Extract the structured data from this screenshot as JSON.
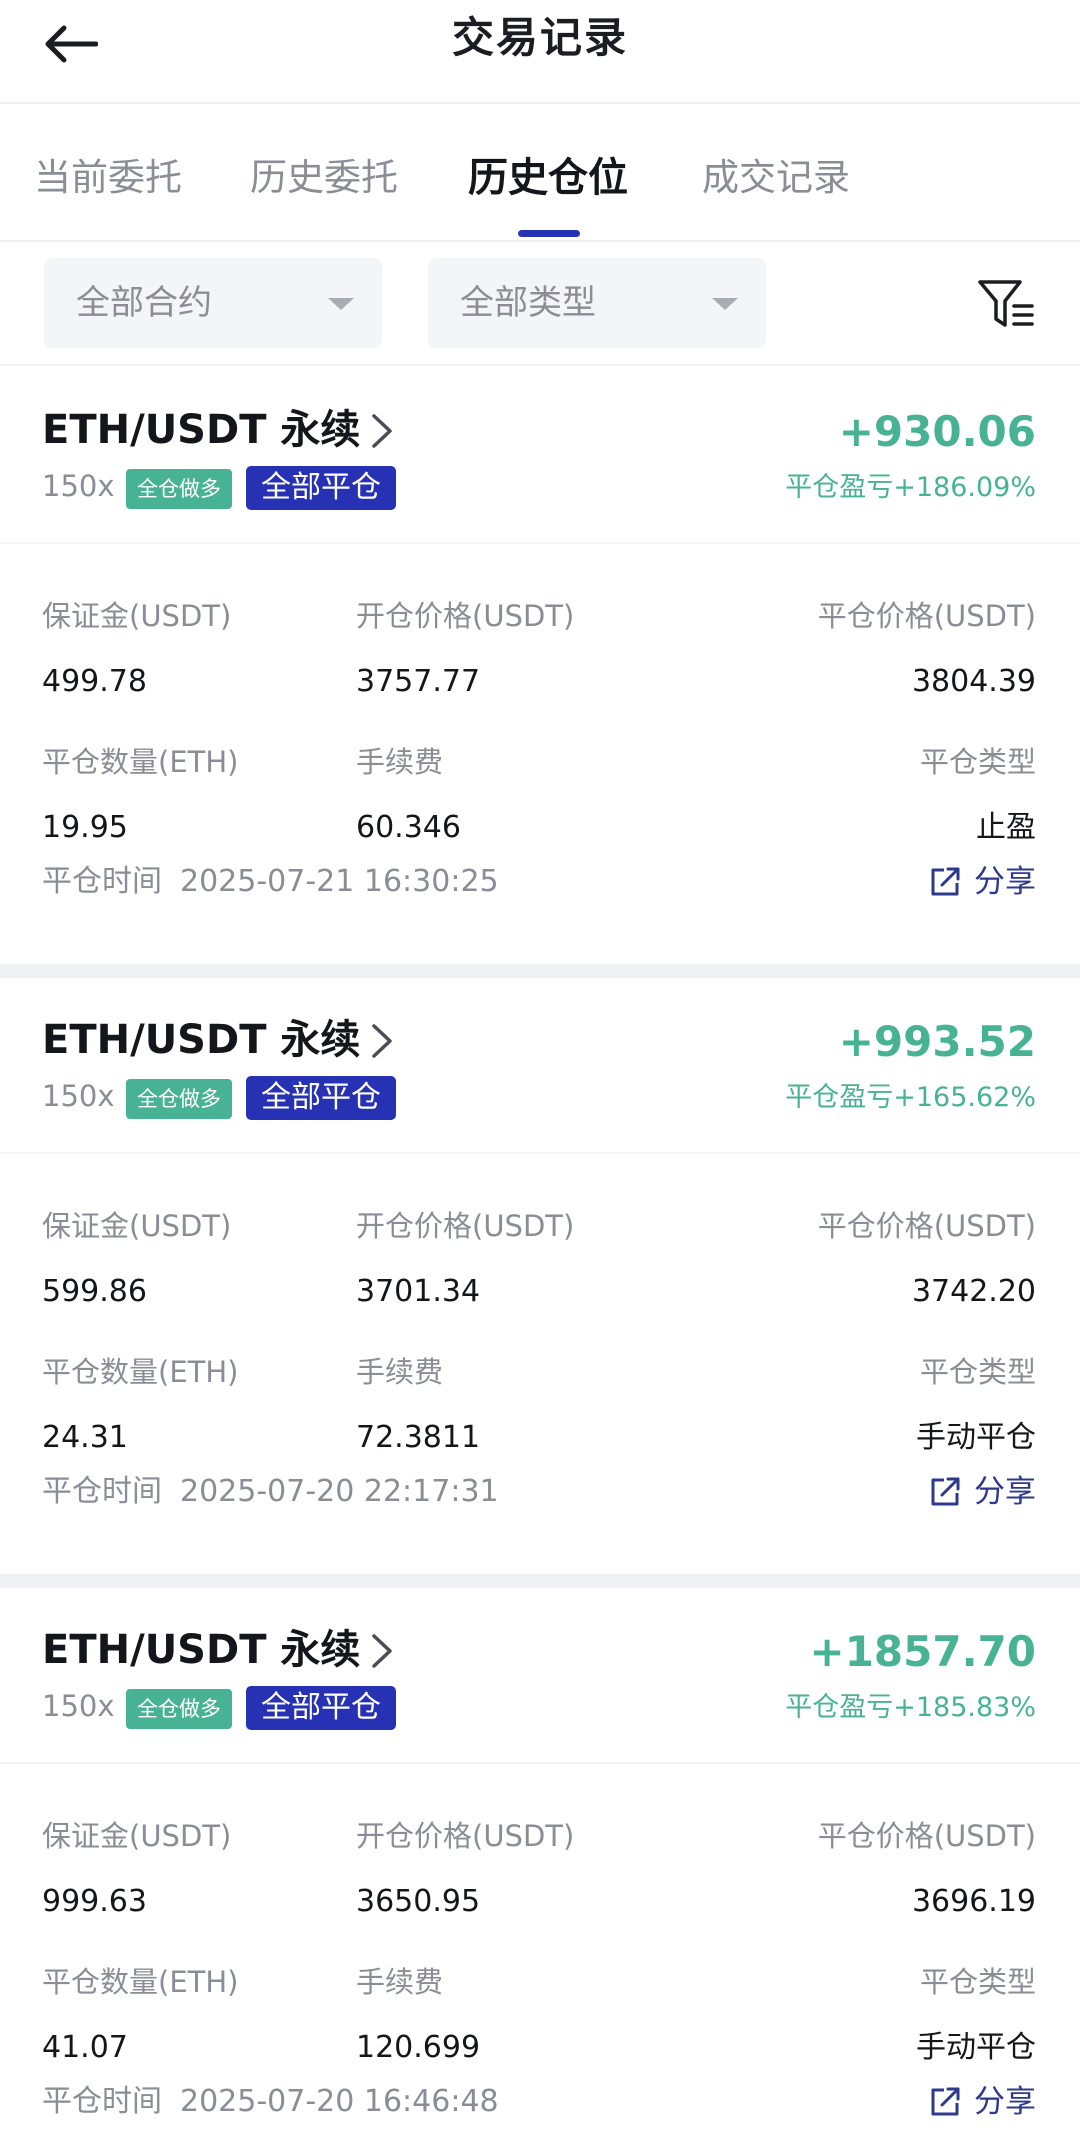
{
  "header": {
    "title": "交易记录"
  },
  "tabs": [
    {
      "label": "当前委托"
    },
    {
      "label": "历史委托"
    },
    {
      "label": "历史仓位"
    },
    {
      "label": "成交记录"
    }
  ],
  "filters": {
    "contract": "全部合约",
    "type": "全部类型"
  },
  "labels": {
    "margin": "保证金(USDT)",
    "open_price": "开仓价格(USDT)",
    "close_price": "平仓价格(USDT)",
    "close_qty": "平仓数量(ETH)",
    "fee": "手续费",
    "close_type": "平仓类型",
    "close_time": "平仓时间",
    "share": "分享"
  },
  "positions": [
    {
      "pair": "ETH/USDT 永续",
      "leverage": "150x",
      "margin_mode": "全仓做多",
      "close_status": "全部平仓",
      "pnl": "+930.06",
      "pnl_rate": "平仓盈亏+186.09%",
      "margin": "499.78",
      "open_price": "3757.77",
      "close_price": "3804.39",
      "close_qty": "19.95",
      "fee": "60.346",
      "close_type": "止盈",
      "close_time": "2025-07-21 16:30:25"
    },
    {
      "pair": "ETH/USDT 永续",
      "leverage": "150x",
      "margin_mode": "全仓做多",
      "close_status": "全部平仓",
      "pnl": "+993.52",
      "pnl_rate": "平仓盈亏+165.62%",
      "margin": "599.86",
      "open_price": "3701.34",
      "close_price": "3742.20",
      "close_qty": "24.31",
      "fee": "72.3811",
      "close_type": "手动平仓",
      "close_time": "2025-07-20 22:17:31"
    },
    {
      "pair": "ETH/USDT 永续",
      "leverage": "150x",
      "margin_mode": "全仓做多",
      "close_status": "全部平仓",
      "pnl": "+1857.70",
      "pnl_rate": "平仓盈亏+185.83%",
      "margin": "999.63",
      "open_price": "3650.95",
      "close_price": "3696.19",
      "close_qty": "41.07",
      "fee": "120.699",
      "close_type": "手动平仓",
      "close_time": "2025-07-20 16:46:48"
    }
  ],
  "colors": {
    "profit": "#48b394",
    "accent": "#2731b3",
    "muted": "#8a8d96"
  },
  "icons": {
    "back": "arrow-left-icon",
    "filter": "filter-list-icon",
    "chevron": "chevron-right-icon",
    "share": "share-external-icon"
  }
}
